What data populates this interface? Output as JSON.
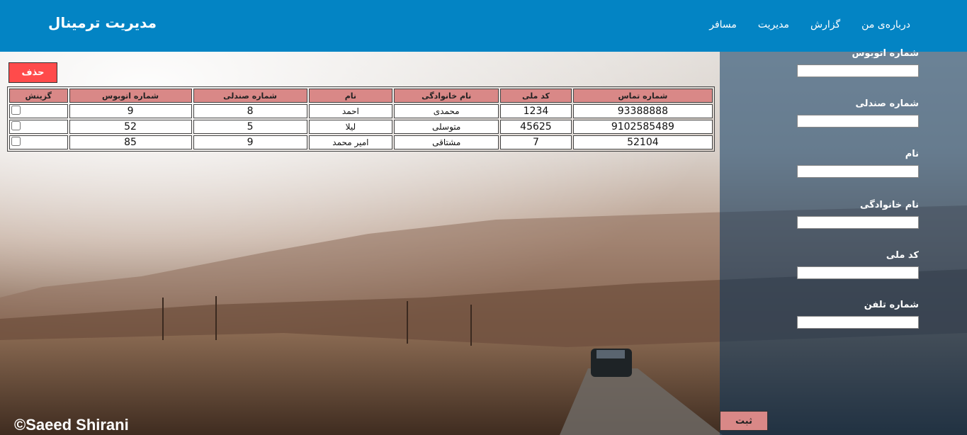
{
  "header": {
    "brand": "مدیریت ترمینال",
    "nav": [
      "درباره‌ی من",
      "گزارش",
      "مدیریت",
      "مسافر"
    ]
  },
  "form": {
    "fields": [
      {
        "label": "شماره اتوبوس",
        "value": ""
      },
      {
        "label": "شماره صندلی",
        "value": ""
      },
      {
        "label": "نام",
        "value": ""
      },
      {
        "label": "نام خانوادگی",
        "value": ""
      },
      {
        "label": "کد ملی",
        "value": ""
      },
      {
        "label": "شماره تلفن",
        "value": ""
      }
    ],
    "submit_label": "ثبت"
  },
  "table": {
    "delete_label": "حذف",
    "headers": [
      "شماره تماس",
      "کد ملی",
      "نام خانوادگی",
      "نام",
      "شماره صندلی",
      "شماره اتوبوس",
      "گزینش"
    ],
    "rows": [
      {
        "phone": "93388888",
        "national_id": "1234",
        "last_name": "محمدی",
        "first_name": "احمد",
        "seat": "8",
        "bus": "9"
      },
      {
        "phone": "9102585489",
        "national_id": "45625",
        "last_name": "متوسلی",
        "first_name": "لیلا",
        "seat": "5",
        "bus": "52"
      },
      {
        "phone": "52104",
        "national_id": "7",
        "last_name": "مشتاقی",
        "first_name": "امیر محمد",
        "seat": "9",
        "bus": "85"
      }
    ]
  },
  "footer": {
    "copyright": "©Saeed Shirani"
  }
}
